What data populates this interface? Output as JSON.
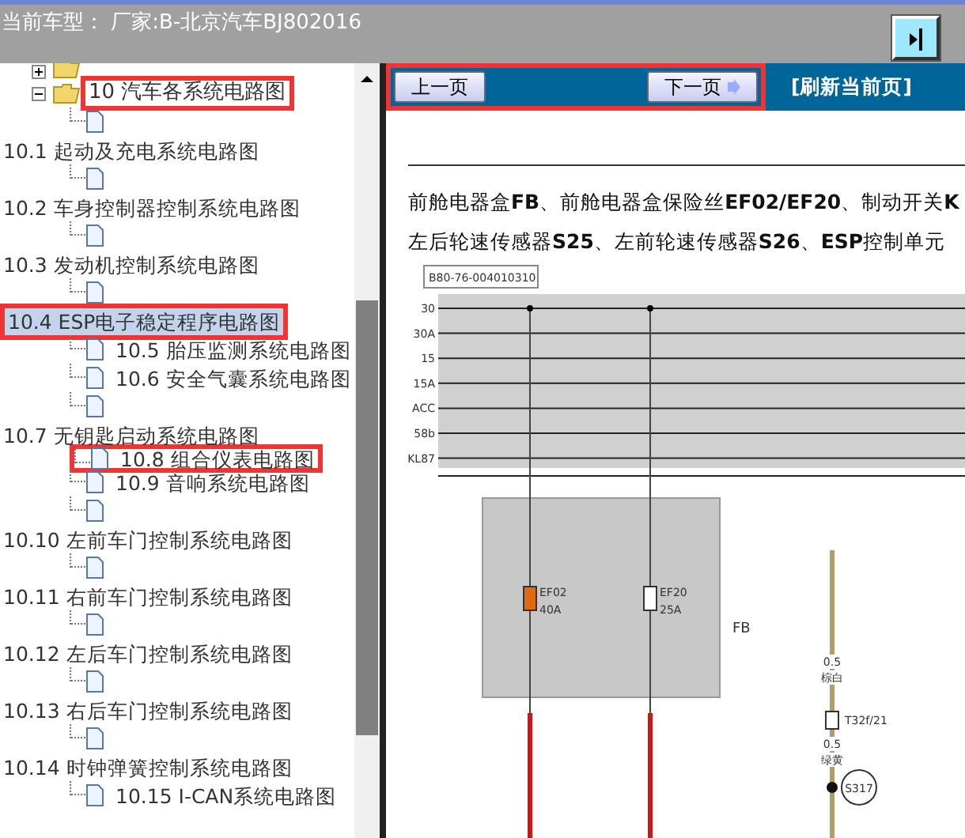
{
  "header": {
    "title": "当前车型： 厂家:B-北京汽车BJ802016"
  },
  "tree_rows": [
    {
      "kind": "folder",
      "label": "",
      "expanded": false,
      "highlighted": false
    },
    {
      "kind": "folder",
      "label": "10 汽车各系统电路图",
      "expanded": true,
      "highlighted": true
    },
    {
      "kind": "doc",
      "label": "",
      "highlighted": false
    },
    {
      "kind": "text",
      "label": "10.1 起动及充电系统电路图",
      "selected": false,
      "highlighted": false
    },
    {
      "kind": "doc",
      "label": "",
      "highlighted": false
    },
    {
      "kind": "text",
      "label": "10.2 车身控制器控制系统电路图",
      "selected": false,
      "highlighted": false
    },
    {
      "kind": "doc",
      "label": "",
      "highlighted": false
    },
    {
      "kind": "text",
      "label": "10.3 发动机控制系统电路图",
      "selected": false,
      "highlighted": false
    },
    {
      "kind": "doc",
      "label": "",
      "highlighted": false
    },
    {
      "kind": "text",
      "label": "10.4 ESP电子稳定程序电路图",
      "selected": true,
      "highlighted": true
    },
    {
      "kind": "doc",
      "label": "10.5 胎压监测系统电路图",
      "highlighted": false
    },
    {
      "kind": "doc",
      "label": "10.6 安全气囊系统电路图",
      "highlighted": false
    },
    {
      "kind": "doc",
      "label": "",
      "highlighted": false
    },
    {
      "kind": "text",
      "label": "10.7 无钥匙启动系统电路图",
      "selected": false,
      "highlighted": false
    },
    {
      "kind": "doc",
      "label": "10.8 组合仪表电路图",
      "highlighted": true
    },
    {
      "kind": "doc",
      "label": "10.9 音响系统电路图",
      "highlighted": false
    },
    {
      "kind": "doc",
      "label": "",
      "highlighted": false
    },
    {
      "kind": "text",
      "label": "10.10 左前车门控制系统电路图",
      "selected": false,
      "highlighted": false
    },
    {
      "kind": "doc",
      "label": "",
      "highlighted": false
    },
    {
      "kind": "text",
      "label": "10.11 右前车门控制系统电路图",
      "selected": false,
      "highlighted": false
    },
    {
      "kind": "doc",
      "label": "",
      "highlighted": false
    },
    {
      "kind": "text",
      "label": "10.12 左后车门控制系统电路图",
      "selected": false,
      "highlighted": false
    },
    {
      "kind": "doc",
      "label": "",
      "highlighted": false
    },
    {
      "kind": "text",
      "label": "10.13 右后车门控制系统电路图",
      "selected": false,
      "highlighted": false
    },
    {
      "kind": "doc",
      "label": "",
      "highlighted": false
    },
    {
      "kind": "text",
      "label": "10.14 时钟弹簧控制系统电路图",
      "selected": false,
      "highlighted": false
    },
    {
      "kind": "doc",
      "label": "10.15 I-CAN系统电路图",
      "highlighted": false
    }
  ],
  "toolbar": {
    "prev": "上一页",
    "next": "下一页",
    "refresh": "[刷新当前页]",
    "highlighted": true
  },
  "document": {
    "lines": [
      "前舱电器盒**FB**、前舱电器盒保险丝**EF02/EF20**、制动开关**K**",
      "左后轮速传感器**S25**、左前轮速传感器**S26**、**ESP**控制单元"
    ],
    "diagram": {
      "code": "B80-76-004010310",
      "bus_labels": [
        "30",
        "30A",
        "15",
        "15A",
        "ACC",
        "58b",
        "KL87"
      ],
      "fuses": [
        {
          "name": "EF02",
          "rating": "40A",
          "color": "#e06a10"
        },
        {
          "name": "EF20",
          "rating": "25A",
          "color": "#ffffff"
        }
      ],
      "box_label": "FB",
      "wire_labels": [
        "0.5",
        "棕白",
        "T32f/21",
        "0.5",
        "绿黄"
      ],
      "splice": "S317"
    }
  }
}
